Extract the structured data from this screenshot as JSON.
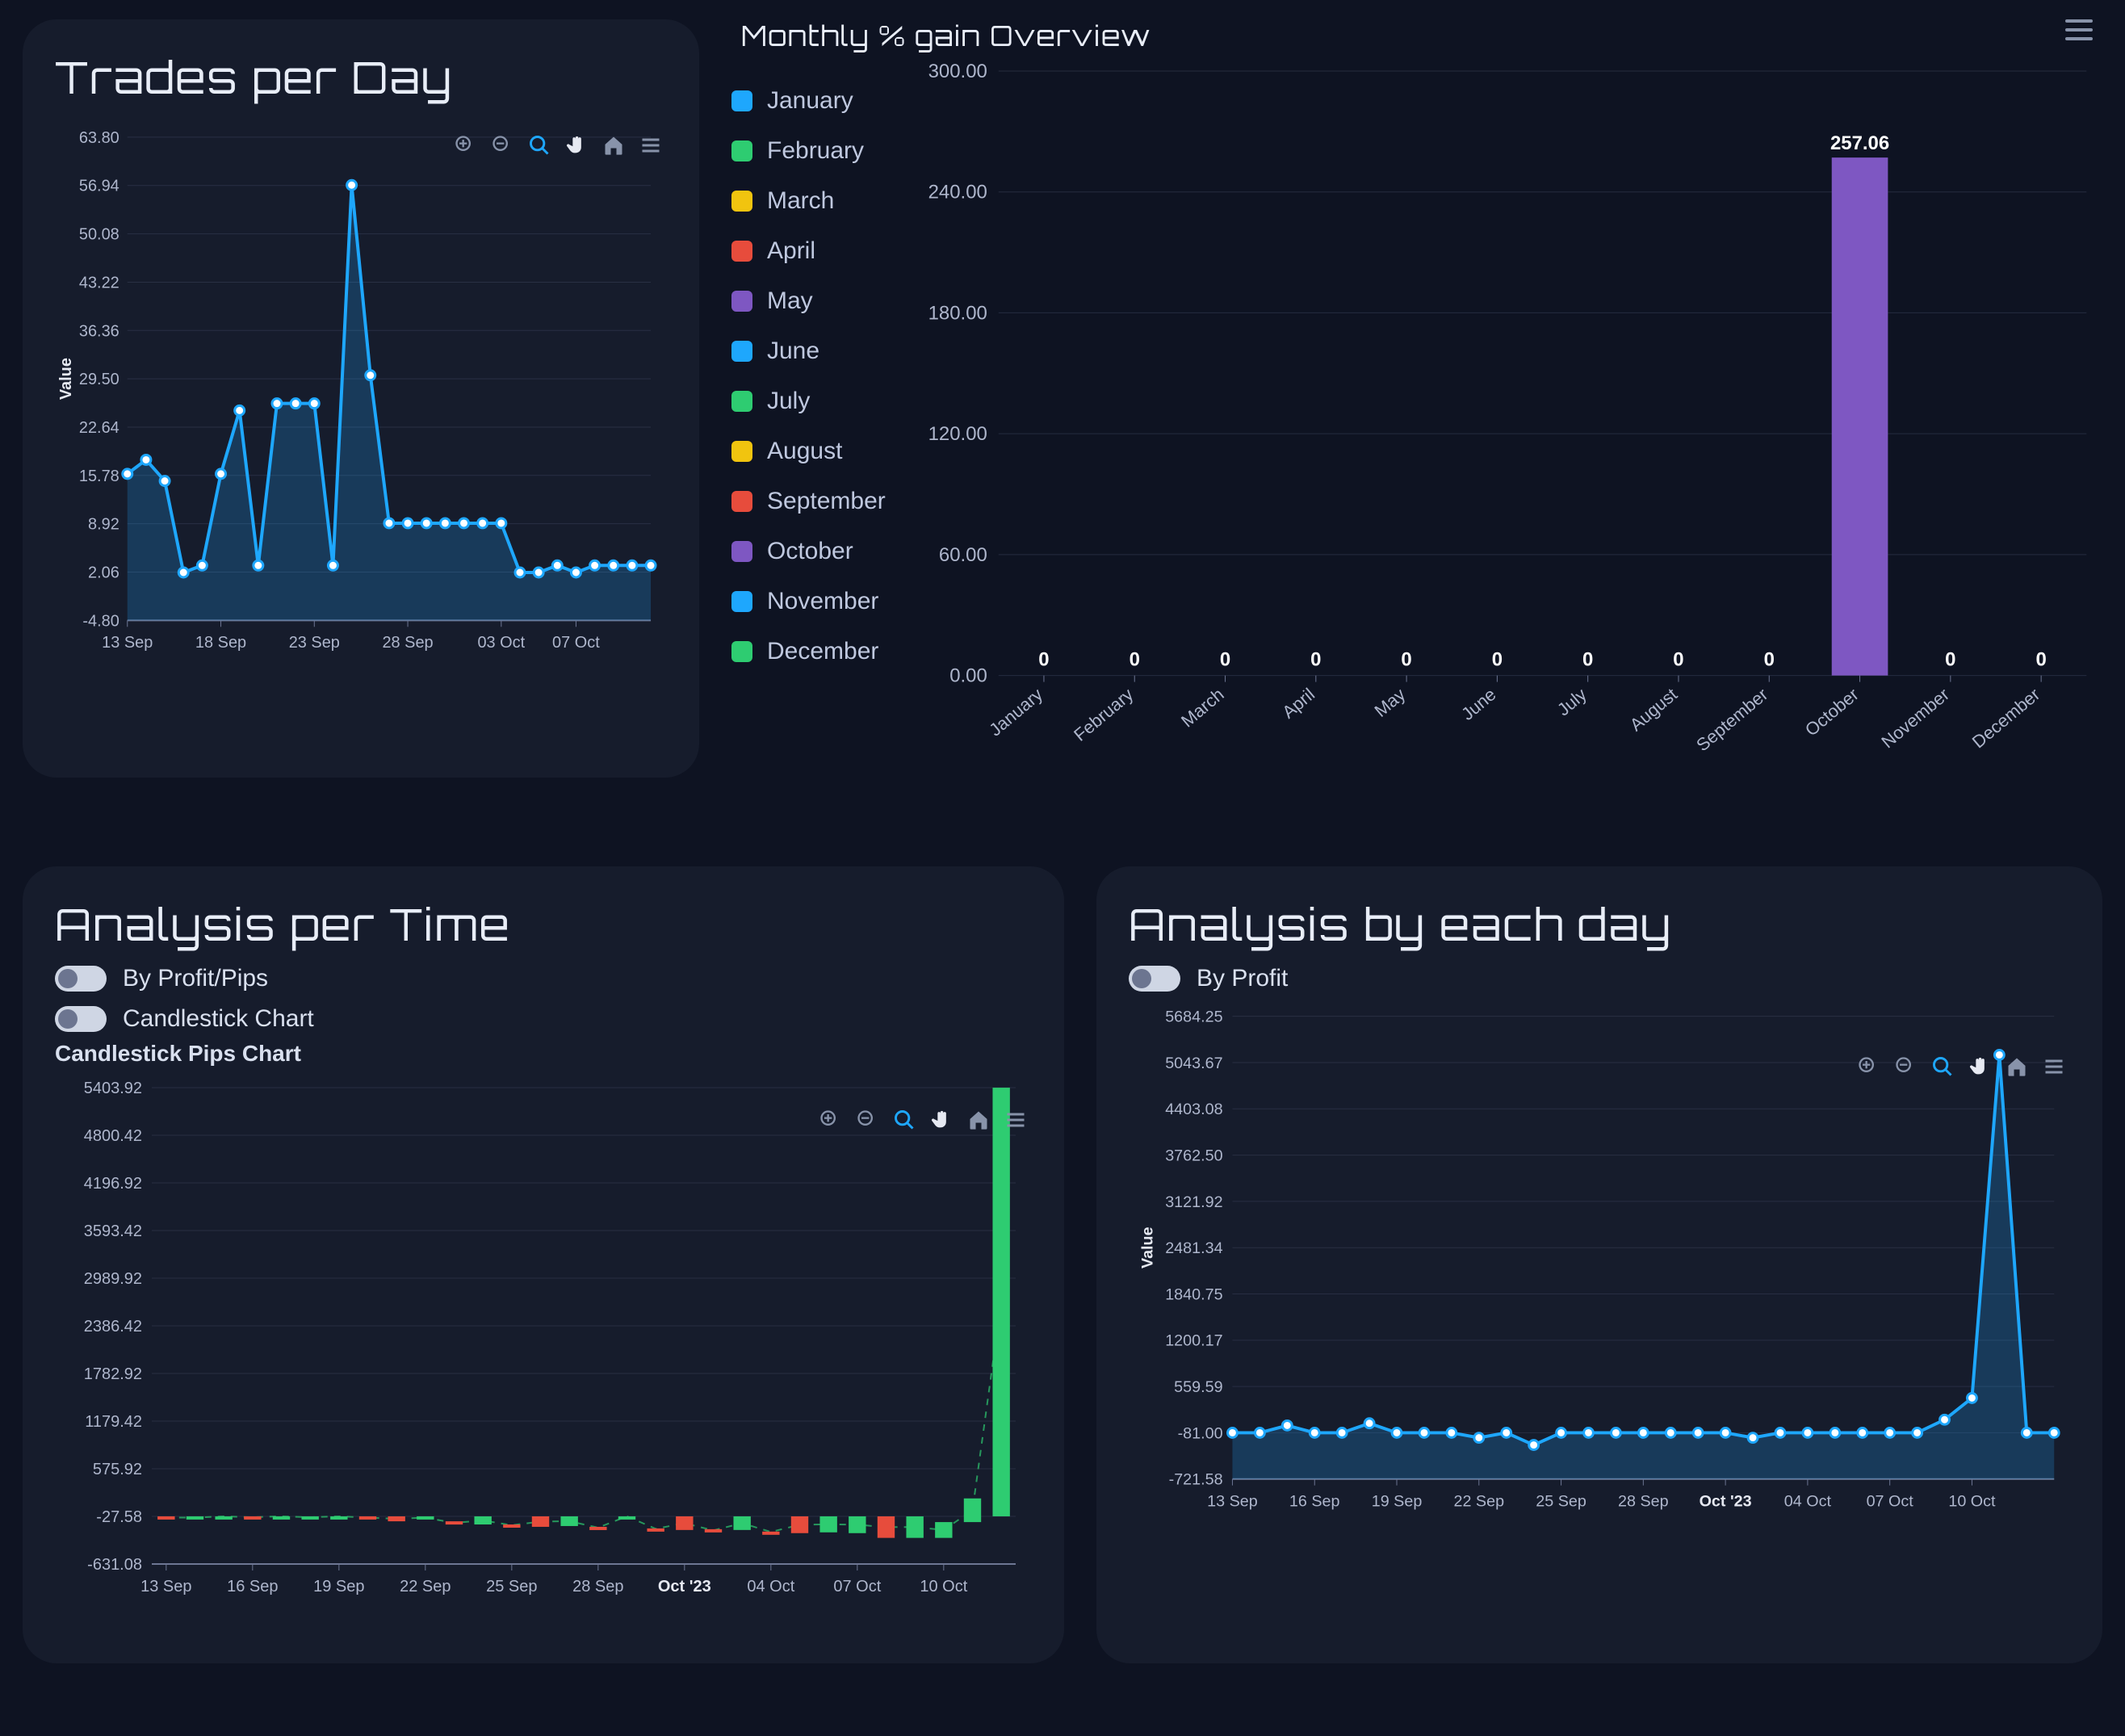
{
  "trades_per_day": {
    "title": "Trades per Day",
    "y_axis_label": "Value",
    "toolbar": [
      "zoom-in",
      "zoom-out",
      "search-zoom",
      "pan",
      "home",
      "menu"
    ]
  },
  "monthly_gain": {
    "title": "Monthly % gain Overview",
    "legend_items": [
      {
        "label": "January",
        "color": "#1ea7fd"
      },
      {
        "label": "February",
        "color": "#2ecc71"
      },
      {
        "label": "March",
        "color": "#f1c40f"
      },
      {
        "label": "April",
        "color": "#e74c3c"
      },
      {
        "label": "May",
        "color": "#7e57c2"
      },
      {
        "label": "June",
        "color": "#1ea7fd"
      },
      {
        "label": "July",
        "color": "#2ecc71"
      },
      {
        "label": "August",
        "color": "#f1c40f"
      },
      {
        "label": "September",
        "color": "#e74c3c"
      },
      {
        "label": "October",
        "color": "#7e57c2"
      },
      {
        "label": "November",
        "color": "#1ea7fd"
      },
      {
        "label": "December",
        "color": "#2ecc71"
      }
    ]
  },
  "analysis_time": {
    "title": "Analysis per Time",
    "toggle1": "By Profit/Pips",
    "toggle2": "Candlestick Chart",
    "subtitle": "Candlestick Pips Chart"
  },
  "analysis_day": {
    "title": "Analysis by each day",
    "toggle1": "By Profit",
    "y_axis_label": "Value"
  },
  "chart_data": [
    {
      "id": "trades_per_day",
      "type": "line",
      "title": "Trades per Day",
      "xlabel": "",
      "ylabel": "Value",
      "y_ticks": [
        -4.8,
        2.06,
        8.92,
        15.78,
        22.64,
        29.5,
        36.36,
        43.22,
        50.08,
        56.94,
        63.8
      ],
      "x_ticks": [
        "13 Sep",
        "18 Sep",
        "23 Sep",
        "28 Sep",
        "03 Oct",
        "07 Oct"
      ],
      "x": [
        "13 Sep",
        "14 Sep",
        "15 Sep",
        "16 Sep",
        "17 Sep",
        "18 Sep",
        "19 Sep",
        "20 Sep",
        "21 Sep",
        "22 Sep",
        "23 Sep",
        "24 Sep",
        "25 Sep",
        "26 Sep",
        "27 Sep",
        "28 Sep",
        "29 Sep",
        "30 Sep",
        "01 Oct",
        "02 Oct",
        "03 Oct",
        "04 Oct",
        "05 Oct",
        "06 Oct",
        "07 Oct",
        "08 Oct",
        "09 Oct",
        "10 Oct",
        "11 Oct"
      ],
      "values": [
        16,
        18,
        15,
        2,
        3,
        16,
        25,
        3,
        26,
        26,
        26,
        3,
        57,
        30,
        9,
        9,
        9,
        9,
        9,
        9,
        9,
        2,
        2,
        3,
        2,
        3,
        3,
        3,
        3
      ],
      "ylim": [
        -4.8,
        63.8
      ]
    },
    {
      "id": "monthly_gain",
      "type": "bar",
      "title": "Monthly % gain Overview",
      "categories": [
        "January",
        "February",
        "March",
        "April",
        "May",
        "June",
        "July",
        "August",
        "September",
        "October",
        "November",
        "December"
      ],
      "values": [
        0,
        0,
        0,
        0,
        0,
        0,
        0,
        0,
        0,
        257.06,
        0,
        0
      ],
      "colors": [
        "#1ea7fd",
        "#2ecc71",
        "#f1c40f",
        "#e74c3c",
        "#7e57c2",
        "#1ea7fd",
        "#2ecc71",
        "#f1c40f",
        "#e74c3c",
        "#7e57c2",
        "#1ea7fd",
        "#2ecc71"
      ],
      "y_ticks": [
        0.0,
        60.0,
        120.0,
        180.0,
        240.0,
        300.0
      ],
      "ylim": [
        0,
        300
      ],
      "data_labels": [
        "0",
        "0",
        "0",
        "0",
        "0",
        "0",
        "0",
        "0",
        "0",
        "257.06",
        "0",
        "0"
      ]
    },
    {
      "id": "analysis_time_candlestick",
      "type": "bar",
      "title": "Candlestick Pips Chart",
      "y_ticks": [
        -631.08,
        -27.58,
        575.92,
        1179.42,
        1782.92,
        2386.42,
        2989.92,
        3593.42,
        4196.92,
        4800.42,
        5403.92
      ],
      "x_ticks": [
        "13 Sep",
        "16 Sep",
        "19 Sep",
        "22 Sep",
        "25 Sep",
        "28 Sep",
        "Oct '23",
        "04 Oct",
        "07 Oct",
        "10 Oct"
      ],
      "ylim": [
        -631.08,
        5403.92
      ],
      "x": [
        "13 Sep",
        "14 Sep",
        "15 Sep",
        "16 Sep",
        "17 Sep",
        "18 Sep",
        "19 Sep",
        "20 Sep",
        "21 Sep",
        "22 Sep",
        "23 Sep",
        "24 Sep",
        "25 Sep",
        "26 Sep",
        "27 Sep",
        "28 Sep",
        "29 Sep",
        "30 Sep",
        "01 Oct",
        "02 Oct",
        "03 Oct",
        "04 Oct",
        "05 Oct",
        "06 Oct",
        "07 Oct",
        "08 Oct",
        "09 Oct",
        "10 Oct",
        "11 Oct",
        "12 Oct"
      ],
      "series": [
        {
          "name": "open",
          "values": [
            -27,
            -60,
            -27,
            -27,
            -27,
            -50,
            -27,
            -27,
            -27,
            -60,
            -90,
            -27,
            -130,
            -27,
            -150,
            -160,
            -27,
            -180,
            -27,
            -190,
            -200,
            -220,
            -27,
            -230,
            -240,
            -27,
            -27,
            -300,
            -100,
            -27
          ]
        },
        {
          "name": "close",
          "values": [
            -60,
            -27,
            -27,
            -50,
            -27,
            -27,
            -27,
            -60,
            -90,
            -27,
            -130,
            -130,
            -150,
            -160,
            -27,
            -180,
            -27,
            -190,
            -200,
            -220,
            -27,
            -230,
            -240,
            -27,
            -27,
            -300,
            -300,
            -100,
            200,
            5403
          ]
        },
        {
          "name": "direction",
          "values": [
            "down",
            "up",
            "flat",
            "down",
            "up",
            "up",
            "up",
            "down",
            "down",
            "up",
            "down",
            "flat",
            "down",
            "down",
            "up",
            "down",
            "up",
            "down",
            "down",
            "down",
            "up",
            "down",
            "down",
            "up",
            "up",
            "down",
            "flat",
            "up",
            "up",
            "up"
          ]
        }
      ]
    },
    {
      "id": "analysis_day_profit",
      "type": "line",
      "title": "Analysis by each day — By Profit",
      "xlabel": "",
      "ylabel": "Value",
      "y_ticks": [
        -721.58,
        -81.0,
        559.59,
        1200.17,
        1840.75,
        2481.34,
        3121.92,
        3762.5,
        4403.08,
        5043.67,
        5684.25
      ],
      "x_ticks": [
        "13 Sep",
        "16 Sep",
        "19 Sep",
        "22 Sep",
        "25 Sep",
        "28 Sep",
        "Oct '23",
        "04 Oct",
        "07 Oct",
        "10 Oct"
      ],
      "x": [
        "13 Sep",
        "14 Sep",
        "15 Sep",
        "16 Sep",
        "17 Sep",
        "18 Sep",
        "19 Sep",
        "20 Sep",
        "21 Sep",
        "22 Sep",
        "23 Sep",
        "24 Sep",
        "25 Sep",
        "26 Sep",
        "27 Sep",
        "28 Sep",
        "29 Sep",
        "30 Sep",
        "01 Oct",
        "02 Oct",
        "03 Oct",
        "04 Oct",
        "05 Oct",
        "06 Oct",
        "07 Oct",
        "08 Oct",
        "09 Oct",
        "10 Oct",
        "11 Oct",
        "12 Oct",
        "13 Oct"
      ],
      "values": [
        -81,
        -81,
        20,
        -81,
        -81,
        50,
        -81,
        -81,
        -81,
        -150,
        -81,
        -250,
        -81,
        -81,
        -81,
        -81,
        -81,
        -81,
        -81,
        -150,
        -81,
        -81,
        -81,
        -81,
        -81,
        -81,
        100,
        400,
        5150,
        -81,
        -81
      ],
      "ylim": [
        -721.58,
        5684.25
      ]
    }
  ]
}
